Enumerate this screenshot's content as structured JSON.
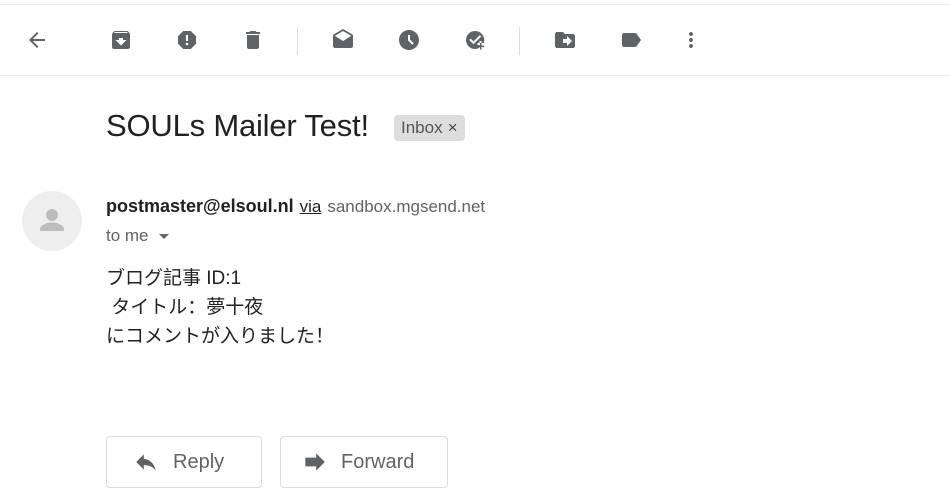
{
  "toolbar": {
    "icons": [
      "back-arrow-icon",
      "archive-icon",
      "report-spam-icon",
      "delete-icon",
      "mark-unread-icon",
      "snooze-icon",
      "add-to-tasks-icon",
      "move-to-icon",
      "label-icon",
      "more-icon"
    ]
  },
  "message": {
    "subject": "SOULs Mailer Test!",
    "label_chip": "Inbox",
    "label_remove": "×",
    "sender_name": "postmaster@elsoul.nl",
    "via": "via",
    "via_domain": "sandbox.mgsend.net",
    "recipient": "to me",
    "body_lines": [
      "ブログ記事 ID:1",
      " タイトル：夢十夜",
      "にコメントが入りました！"
    ]
  },
  "actions": {
    "reply_label": "Reply",
    "forward_label": "Forward"
  }
}
